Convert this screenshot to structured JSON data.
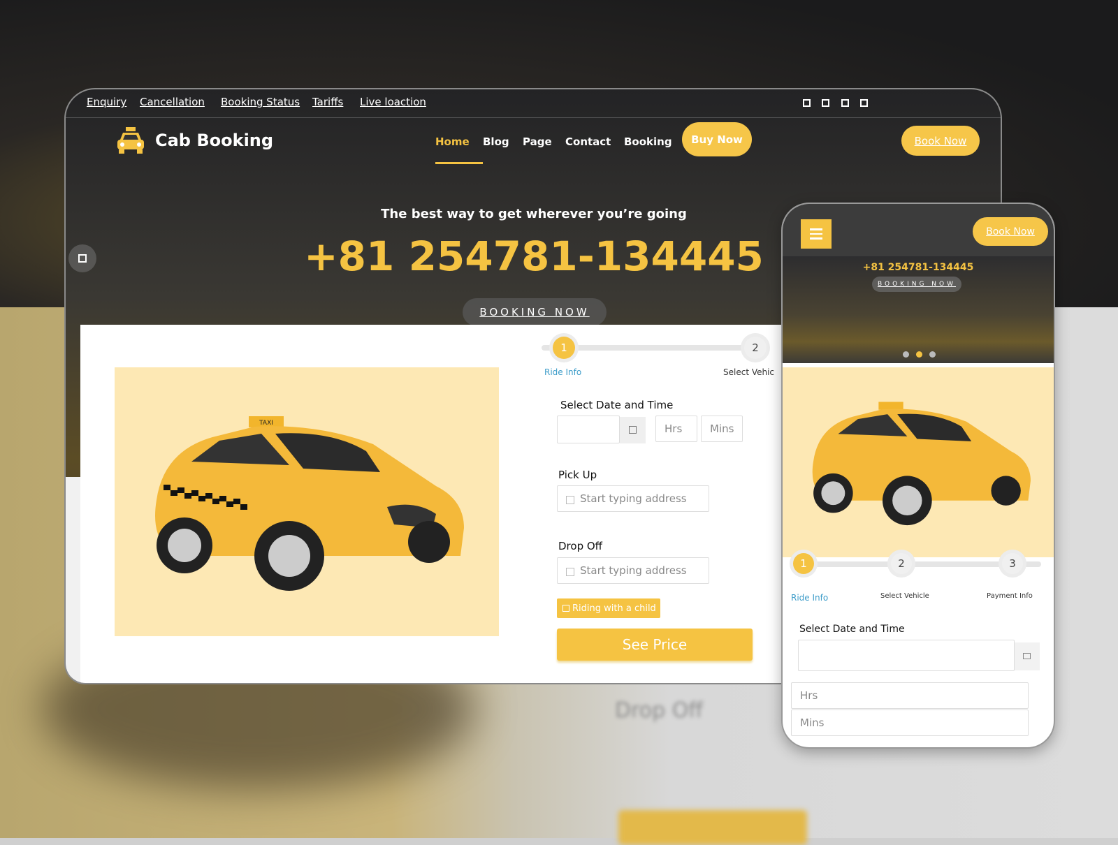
{
  "topbar": {
    "links": [
      "Enquiry",
      "Cancellation",
      "Booking Status",
      "Tariffs",
      "Live loaction"
    ],
    "social_icons": [
      "square-icon",
      "square-icon",
      "square-icon",
      "square-icon"
    ]
  },
  "brand": {
    "name": "Cab Booking",
    "logo_icon": "taxi-icon"
  },
  "nav": {
    "items": [
      "Home",
      "Blog",
      "Page",
      "Contact",
      "Booking"
    ],
    "active": "Home",
    "buy_now": "Buy Now",
    "book_now": "Book Now"
  },
  "hero": {
    "tagline": "The best way to get wherever you’re going",
    "phone": "+81 254781-134445",
    "cta": "BOOKING NOW"
  },
  "steps": [
    {
      "num": "1",
      "label": "Ride Info"
    },
    {
      "num": "2",
      "label": "Select Vehicle"
    },
    {
      "num": "3",
      "label": "Payment Info"
    }
  ],
  "desktop_steps": {
    "step2_label": "Select Vehic"
  },
  "form": {
    "date_label": "Select Date and Time",
    "hrs": "Hrs",
    "mins": "Mins",
    "pickup_label": "Pick Up",
    "pickup_placeholder": "Start typing address",
    "dropoff_label": "Drop Off",
    "dropoff_placeholder": "Start typing address",
    "child": "Riding with a child",
    "submit": "See Price"
  },
  "colors": {
    "accent": "#f5c342",
    "link": "#3c9cc9",
    "image_bg": "#fde8b4"
  },
  "taxi_sign": "TAXI",
  "carousel": {
    "count": 3,
    "active": 2
  }
}
